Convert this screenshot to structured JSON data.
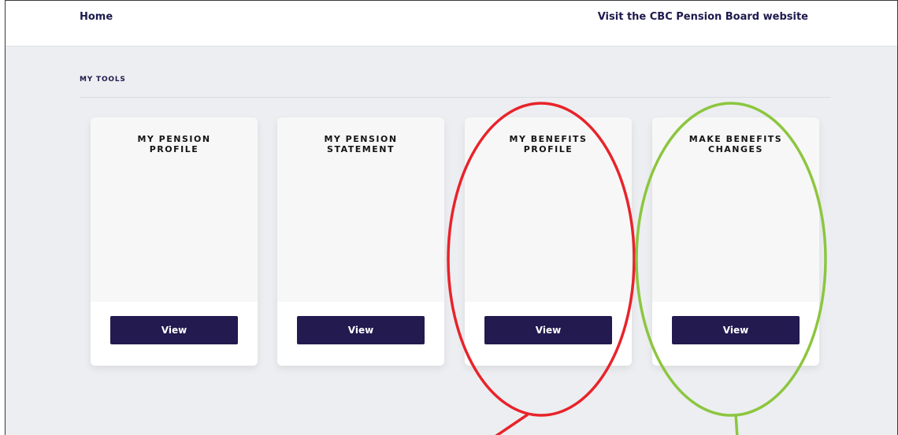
{
  "nav": {
    "home_label": "Home",
    "visit_label": "Visit the CBC Pension Board website"
  },
  "section": {
    "title": "MY TOOLS"
  },
  "cards": [
    {
      "title": "MY PENSION\nPROFILE",
      "button_label": "View"
    },
    {
      "title": "MY PENSION\nSTATEMENT",
      "button_label": "View"
    },
    {
      "title": "MY BENEFITS\nPROFILE",
      "button_label": "View"
    },
    {
      "title": "MAKE BENEFITS\nCHANGES",
      "button_label": "View"
    }
  ],
  "annotations": {
    "red_color": "#e8232a",
    "green_color": "#8cc63f"
  }
}
